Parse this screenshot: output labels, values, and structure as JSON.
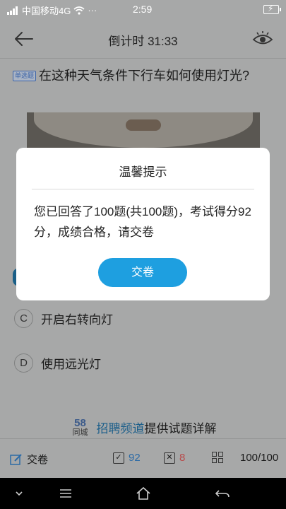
{
  "status_bar": {
    "carrier": "中国移动4G",
    "more": "···",
    "time": "2:59"
  },
  "header": {
    "title": "倒计时 31:33"
  },
  "question": {
    "tag": "单选题",
    "text": "在这种天气条件下行车如何使用灯光?"
  },
  "options": [
    {
      "letter": "C",
      "text": "开启右转向灯"
    },
    {
      "letter": "D",
      "text": "使用远光灯"
    }
  ],
  "promo": {
    "logo_number": "58",
    "logo_text": "同城",
    "link": "招聘频道",
    "suffix": "提供试题详解"
  },
  "bottom_bar": {
    "submit_label": "交卷",
    "correct_count": "92",
    "wrong_count": "8",
    "progress": "100/100",
    "colors": {
      "correct": "#2b6aa6",
      "wrong": "#b84a4a"
    }
  },
  "dialog": {
    "title": "温馨提示",
    "message": "您已回答了100题(共100题)，考试得分92分，成绩合格，请交卷",
    "button": "交卷",
    "colors": {
      "button": "#1e9fe0"
    }
  }
}
